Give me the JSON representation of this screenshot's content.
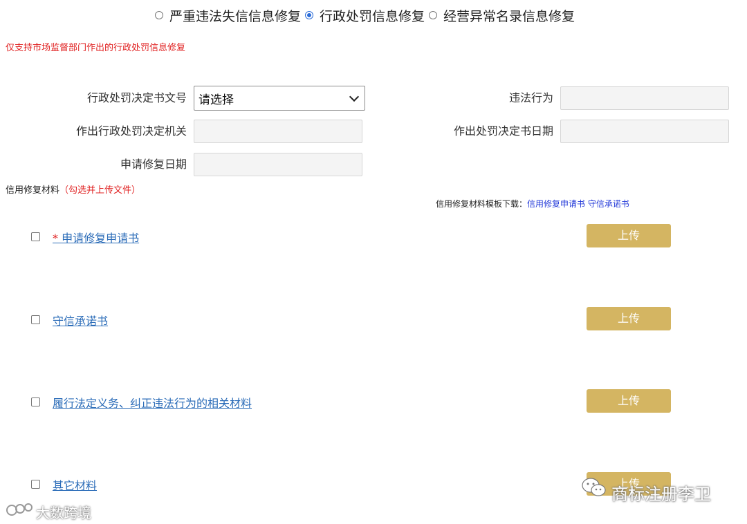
{
  "radio_options": [
    {
      "label": "严重违法失信信息修复",
      "checked": false
    },
    {
      "label": "行政处罚信息修复",
      "checked": true
    },
    {
      "label": "经营异常名录信息修复",
      "checked": false
    }
  ],
  "notice": "仅支持市场监督部门作出的行政处罚信息修复",
  "form": {
    "decision_no_label": "行政处罚决定书文号",
    "decision_no_value": "请选择",
    "violation_label": "违法行为",
    "authority_label": "作出行政处罚决定机关",
    "decision_date_label": "作出处罚决定书日期",
    "apply_date_label": "申请修复日期"
  },
  "materials": {
    "title": "信用修复材料",
    "hint": "（勾选并上传文件）",
    "template_prefix": "信用修复材料模板下载：",
    "template_links": [
      "信用修复申请书",
      "守信承诺书"
    ],
    "items": [
      {
        "required_mark": "*",
        "label": "申请修复申请书"
      },
      {
        "required_mark": "",
        "label": "守信承诺书"
      },
      {
        "required_mark": "",
        "label": "履行法定义务、纠正违法行为的相关材料"
      },
      {
        "required_mark": "",
        "label": "其它材料"
      }
    ],
    "upload_label": "上传"
  },
  "watermarks": {
    "left": "大数跨境",
    "right": "商标注册李卫"
  },
  "colors": {
    "accent_blue": "#2b6cd8",
    "notice_red": "#e02020",
    "upload_gold": "#d4b562",
    "link_blue": "#2b6cb8"
  }
}
